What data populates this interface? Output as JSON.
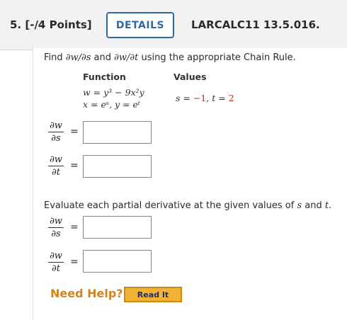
{
  "header": {
    "question_label": "5. [-/4 Points]",
    "details_button": "DETAILS",
    "course_code": "LARCALC11 13.5.016."
  },
  "problem": {
    "prompt_pre": "Find ",
    "prompt_dw_ds": "∂w/∂s",
    "prompt_and": " and ",
    "prompt_dw_dt": "∂w/∂t",
    "prompt_post": " using the appropriate Chain Rule.",
    "function_header": "Function",
    "values_header": "Values",
    "function_line1": "w = y³ − 9x²y",
    "function_line2": "x = eˢ,  y = eᵗ",
    "values_s_label": "s = ",
    "values_s_value": "−1",
    "values_sep": ",  t = ",
    "values_t_value": "2"
  },
  "derivatives": {
    "numerator": "∂w",
    "denom_s": "∂s",
    "denom_t": "∂t",
    "equals": "="
  },
  "evaluate": {
    "text_pre": "Evaluate each partial derivative at the given values of ",
    "var_s": "s",
    "text_and": " and ",
    "var_t": "t",
    "text_end": "."
  },
  "help": {
    "need_help": "Need Help?",
    "read_it": "Read It"
  },
  "colors": {
    "accent": "#2c6aa6",
    "value_red": "#c62828",
    "help_orange": "#d4841b",
    "read_it_bg": "#f2b233"
  }
}
